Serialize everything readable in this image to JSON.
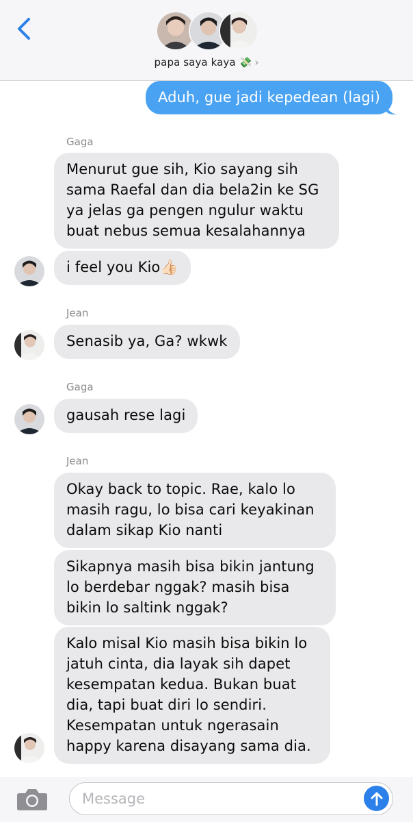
{
  "header": {
    "group_name": "papa saya kaya 💸",
    "chevron": "›",
    "avatar_count": 3
  },
  "messages": [
    {
      "sender": "me",
      "text": "Aduh, gue jadi kepedean (lagi)"
    },
    {
      "sender": "Gaga",
      "text": "Menurut gue sih, Kio sayang sih\nsama Raefal dan dia bela2in ke SG\nya jelas ga pengen ngulur waktu\nbuat nebus semua kesalahannya"
    },
    {
      "sender": "Gaga",
      "text": "i feel you Kio👍🏻"
    },
    {
      "sender": "Jean",
      "text": "Senasib ya, Ga? wkwk"
    },
    {
      "sender": "Gaga",
      "text": "gausah rese lagi"
    },
    {
      "sender": "Jean",
      "text": "Okay back to topic. Rae, kalo lo\nmasih ragu, lo bisa cari keyakinan\ndalam sikap Kio nanti"
    },
    {
      "sender": "Jean",
      "text": "Sikapnya masih bisa bikin jantung\nlo berdebar nggak? masih bisa\nbikin lo saltink nggak?"
    },
    {
      "sender": "Jean",
      "text": "Kalo misal Kio masih bisa bikin lo\njatuh cinta, dia layak sih dapet\nkesempatan kedua. Bukan buat\ndia, tapi buat diri lo sendiri.\nKesempatan untuk ngerasain\nhappy karena disayang sama dia."
    }
  ],
  "sender_labels": {
    "gaga_1": "Gaga",
    "jean_1": "Jean",
    "gaga_2": "Gaga",
    "jean_2": "Jean"
  },
  "compose": {
    "placeholder": "Message",
    "value": ""
  },
  "colors": {
    "incoming_bubble": "#e9e9eb",
    "outgoing_bubble": "#4aa3f2",
    "accent": "#2b80ea",
    "header_bg": "#f6f6f8"
  },
  "icons": {
    "back": "chevron-left-icon",
    "camera": "camera-icon",
    "send": "arrow-up-icon"
  }
}
